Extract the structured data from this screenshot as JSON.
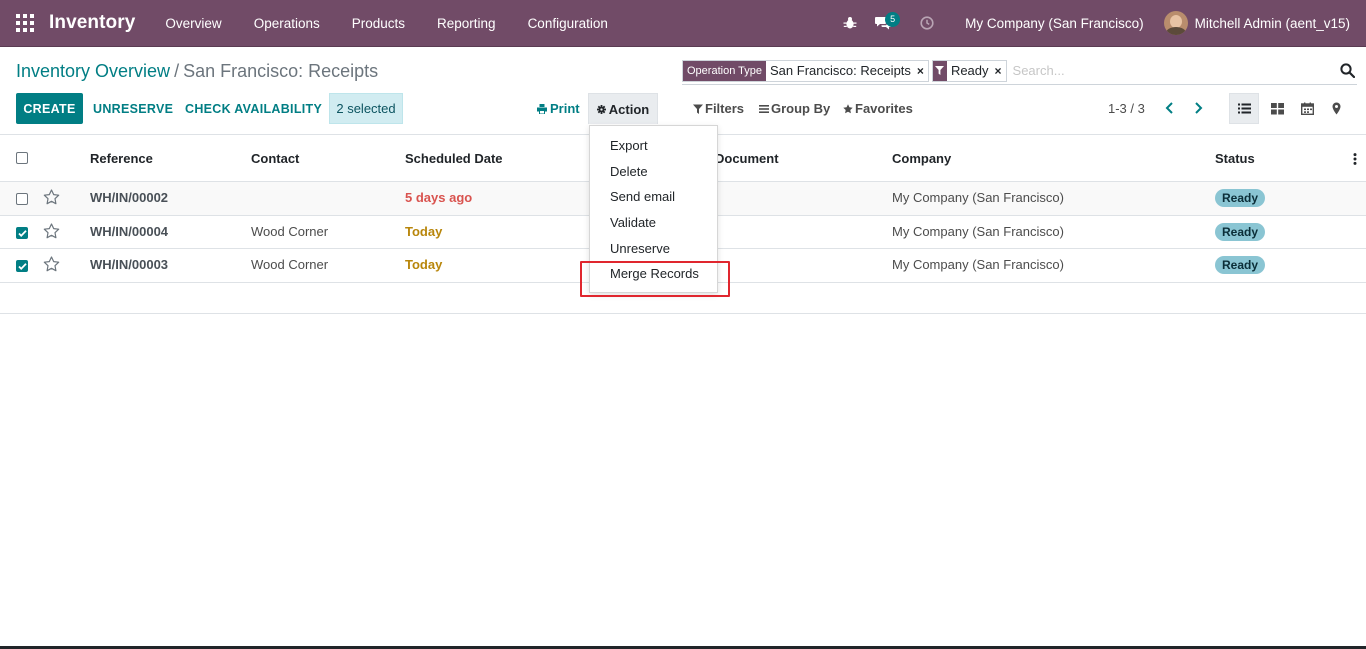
{
  "navbar": {
    "brand": "Inventory",
    "menu": [
      "Overview",
      "Operations",
      "Products",
      "Reporting",
      "Configuration"
    ],
    "messages_count": "5",
    "company": "My Company (San Francisco)",
    "user": "Mitchell Admin (aent_v15)",
    "color": "#714b67"
  },
  "breadcrumb": {
    "parent": "Inventory Overview",
    "separator": "/",
    "current": "San Francisco: Receipts"
  },
  "buttons": {
    "create": "CREATE",
    "unreserve": "UNRESERVE",
    "check_availability": "CHECK AVAILABILITY",
    "selected": "2 selected",
    "print": "Print",
    "action": "Action"
  },
  "search": {
    "facets": [
      {
        "label": "Operation Type",
        "value": "San Francisco: Receipts"
      },
      {
        "label": "filter-icon",
        "value": "Ready"
      }
    ],
    "close_glyph": "×",
    "placeholder": "Search..."
  },
  "search_options": {
    "filters": "Filters",
    "group_by": "Group By",
    "favorites": "Favorites"
  },
  "pager": {
    "value": "1-3 / 3"
  },
  "table": {
    "columns": [
      "Reference",
      "Contact",
      "Scheduled Date",
      "Source Document",
      "Company",
      "Status"
    ],
    "visible_partial_header": "Document",
    "rows": [
      {
        "checked": false,
        "reference": "WH/IN/00002",
        "contact": "",
        "scheduled": "5 days ago",
        "scheduled_style": "overdue",
        "company": "My Company (San Francisco)",
        "status": "Ready"
      },
      {
        "checked": true,
        "reference": "WH/IN/00004",
        "contact": "Wood Corner",
        "scheduled": "Today",
        "scheduled_style": "today",
        "company": "My Company (San Francisco)",
        "status": "Ready"
      },
      {
        "checked": true,
        "reference": "WH/IN/00003",
        "contact": "Wood Corner",
        "scheduled": "Today",
        "scheduled_style": "today",
        "company": "My Company (San Francisco)",
        "status": "Ready"
      }
    ]
  },
  "action_menu": {
    "items": [
      "Export",
      "Delete",
      "Send email",
      "Validate",
      "Unreserve",
      "Merge Records"
    ],
    "highlighted": "Merge Records"
  },
  "colors": {
    "accent": "#017e84",
    "brand": "#714b67",
    "overdue": "#d9534f",
    "today": "#b8860b",
    "status_ready": "#8ac5d3",
    "highlight": "#e0262e"
  }
}
